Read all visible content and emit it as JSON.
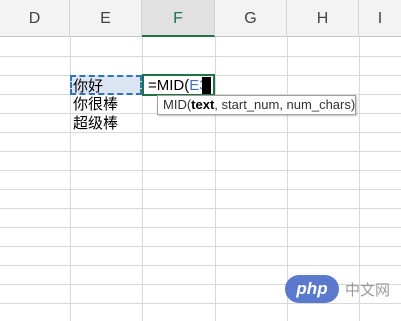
{
  "columns": [
    {
      "label": "D"
    },
    {
      "label": "E"
    },
    {
      "label": "F"
    },
    {
      "label": "G"
    },
    {
      "label": "H"
    },
    {
      "label": "I"
    }
  ],
  "cells": {
    "e3": "你好",
    "e4": "你很棒",
    "e5": "超级棒"
  },
  "formula": {
    "prefix": "=MID(",
    "reference": "E3"
  },
  "tooltip": {
    "func": "MID(",
    "arg_active": "text",
    "rest": ", start_num, num_chars)"
  },
  "watermark": {
    "logo": "php",
    "text": "中文网"
  },
  "colors": {
    "active_green": "#217346",
    "reference_blue": "#4472c4",
    "selection_fill": "#dbe5f1"
  }
}
